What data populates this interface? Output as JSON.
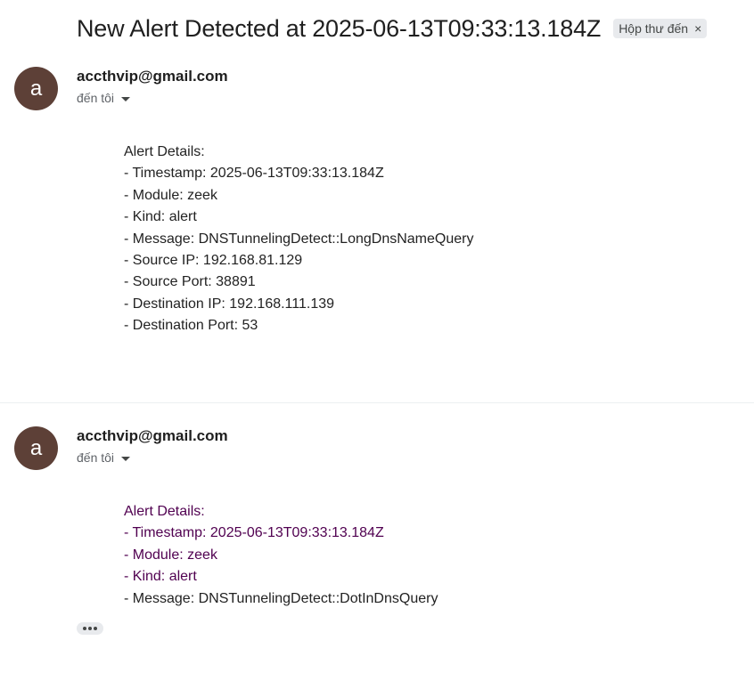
{
  "thread": {
    "subject": "New Alert Detected at 2025-06-13T09:33:13.184Z",
    "label": "Hộp thư đến",
    "label_remove": "×"
  },
  "messages": [
    {
      "avatar_letter": "a",
      "sender": "accthvip@gmail.com",
      "recipient": "đến tôi",
      "lines": [
        "Alert Details:",
        "- Timestamp: 2025-06-13T09:33:13.184Z",
        "- Module: zeek",
        "- Kind: alert",
        "- Message: DNSTunnelingDetect::LongDnsNameQuery",
        "- Source IP: 192.168.81.129",
        "- Source Port: 38891",
        "- Destination IP: 192.168.111.139",
        "- Destination Port: 53"
      ]
    },
    {
      "avatar_letter": "a",
      "sender": "accthvip@gmail.com",
      "recipient": "đến tôi",
      "lines": [
        "Alert Details:",
        "- Timestamp: 2025-06-13T09:33:13.184Z",
        "- Module: zeek",
        "- Kind: alert",
        "- Message: DNSTunnelingDetect::DotInDnsQuery"
      ]
    }
  ],
  "colors": {
    "avatar": "#5d4037",
    "quoted_text": "#500050",
    "label_chip": "#e8eaed"
  },
  "icons": {
    "recipient_toggle": "caret-down-icon",
    "trimmed_content": "ellipsis-icon"
  }
}
